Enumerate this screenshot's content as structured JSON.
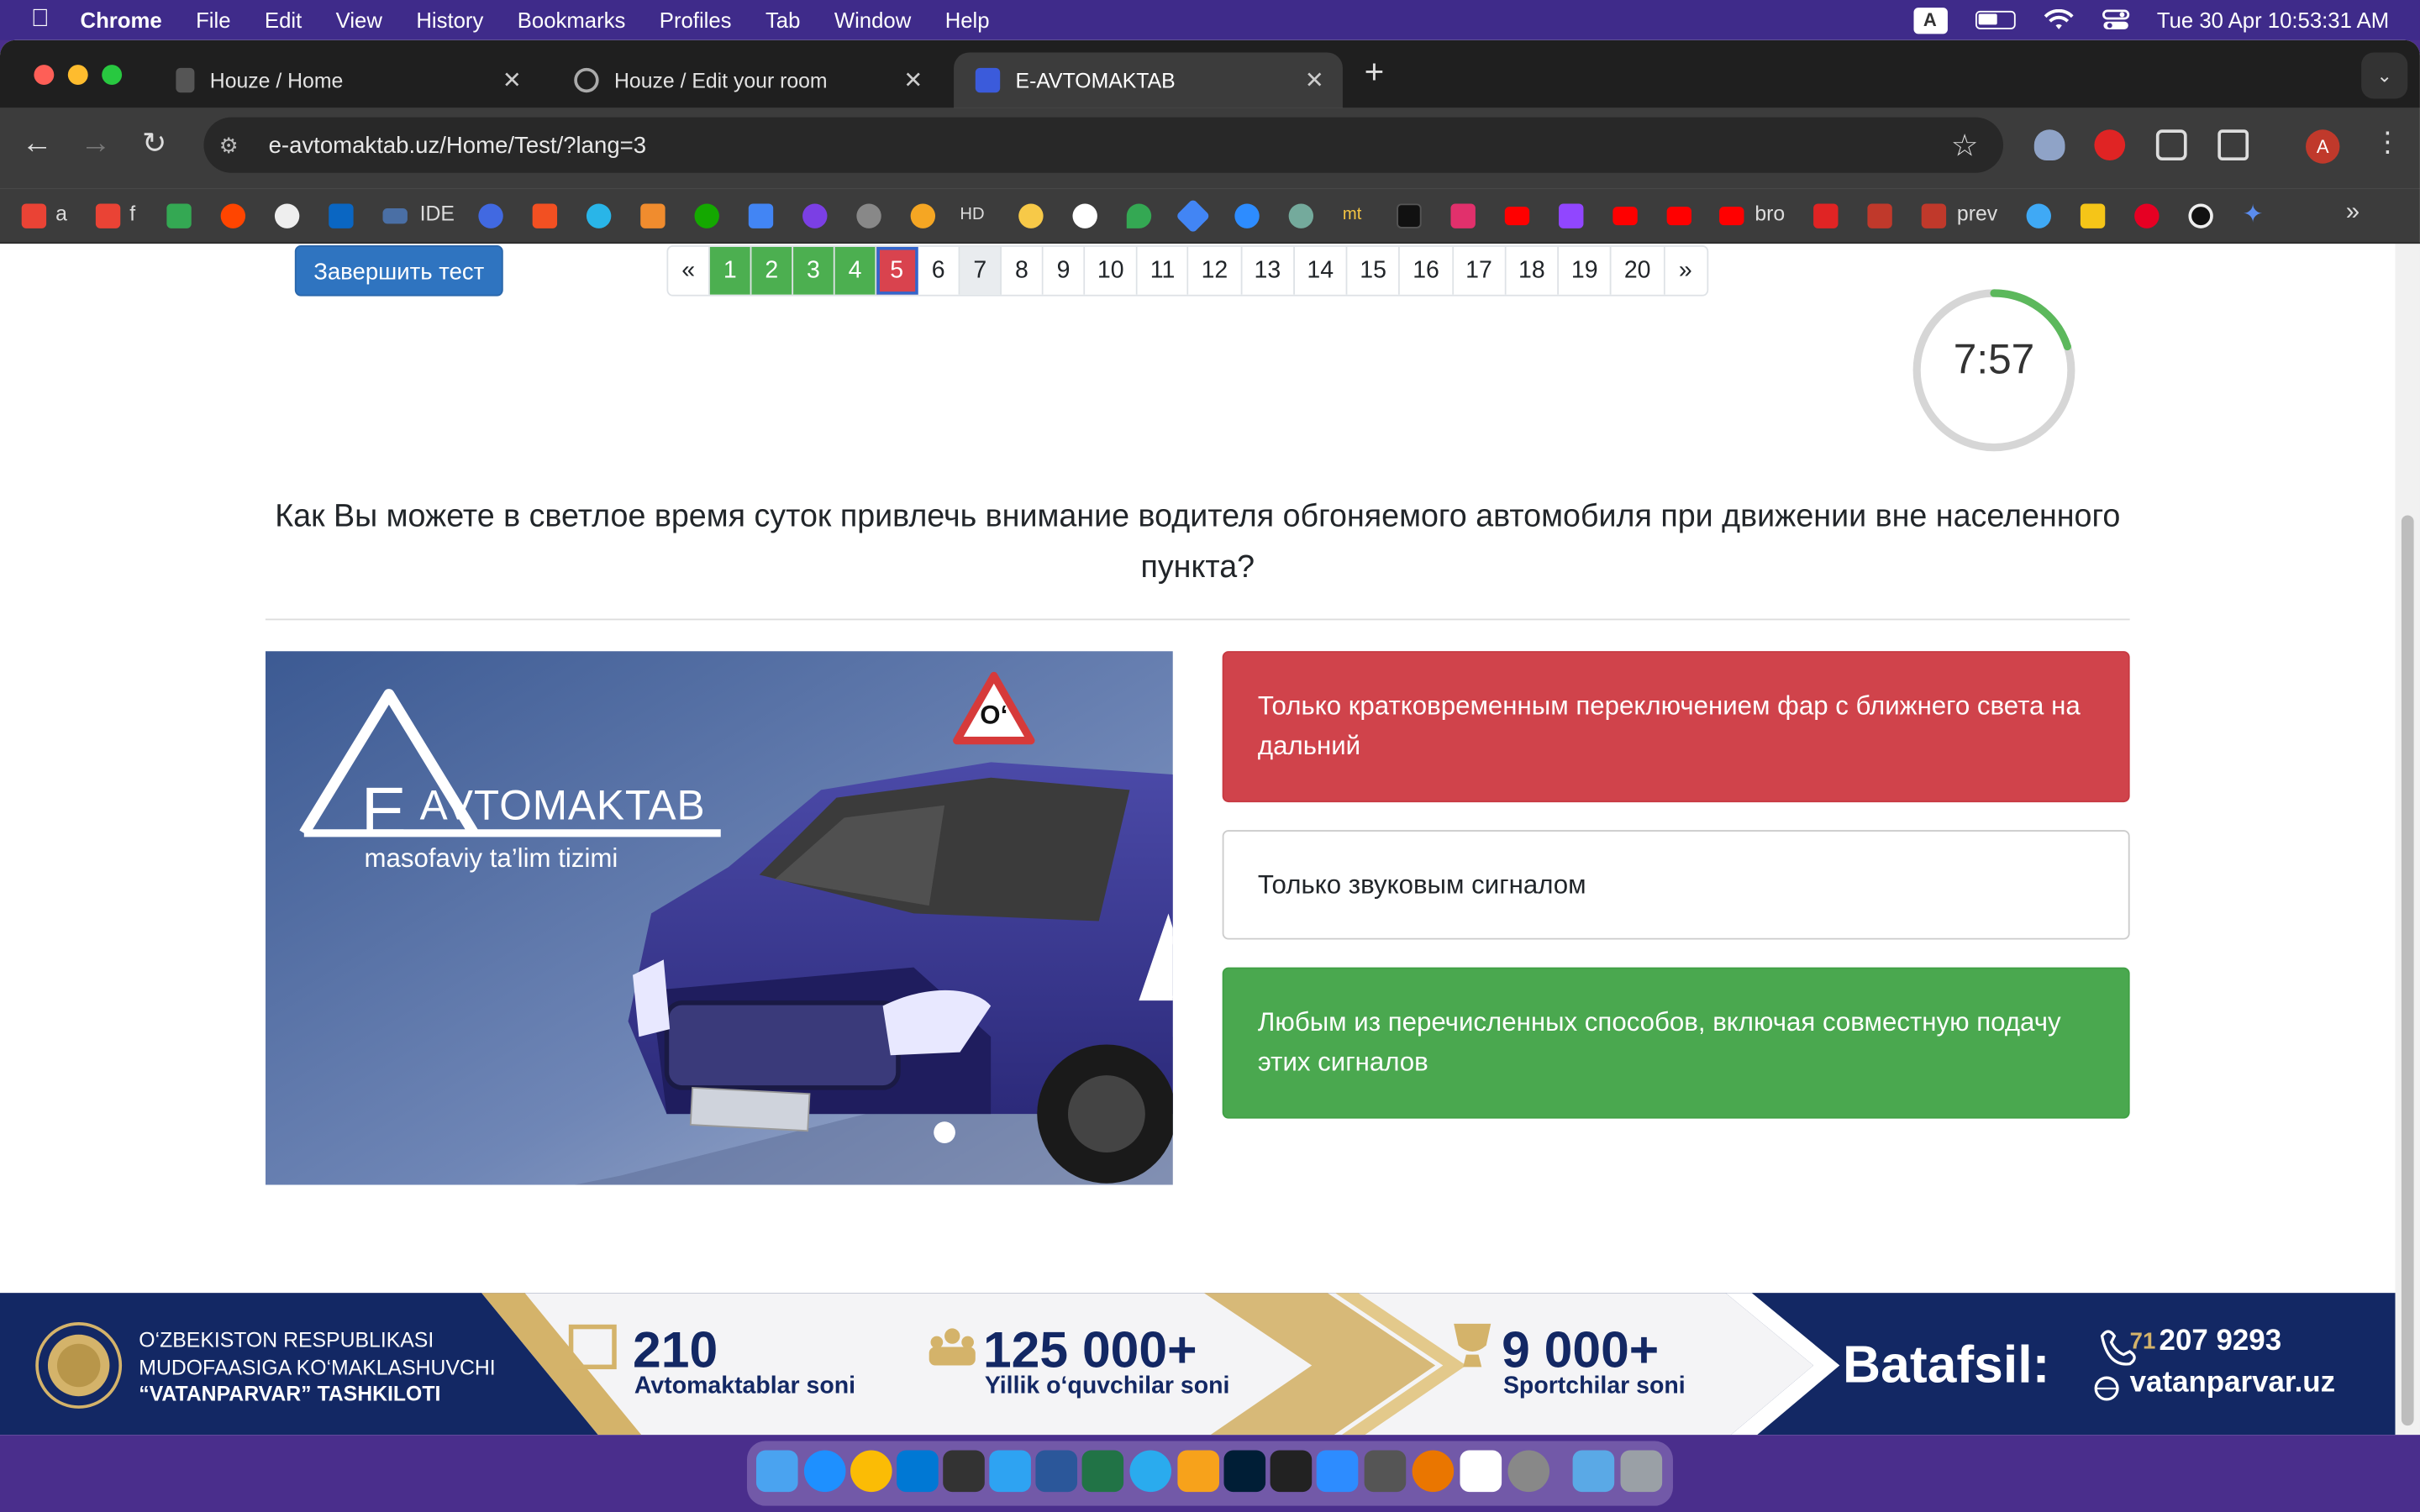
{
  "menubar": {
    "app": "Chrome",
    "items": [
      "File",
      "Edit",
      "View",
      "History",
      "Bookmarks",
      "Profiles",
      "Tab",
      "Window",
      "Help"
    ],
    "input_indicator": "A",
    "datetime": "Tue 30 Apr  10:53:31 AM"
  },
  "tabs": [
    {
      "title": "Houze / Home",
      "active": false
    },
    {
      "title": "Houze / Edit your room",
      "active": false
    },
    {
      "title": "E-AVTOMAKTAB",
      "active": true
    }
  ],
  "omnibox": {
    "url": "e-avtomaktab.uz/Home/Test/?lang=3"
  },
  "profile_initial": "A",
  "bookmarks": {
    "a": "a",
    "f": "f",
    "ide": "IDE",
    "hd": "HD",
    "mt": "mt",
    "bro": "bro",
    "prev": "prev"
  },
  "test": {
    "finish_button": "Завершить тест",
    "pager": {
      "prev": "«",
      "next": "»",
      "pages": [
        {
          "n": "1",
          "state": "correct"
        },
        {
          "n": "2",
          "state": "correct"
        },
        {
          "n": "3",
          "state": "correct"
        },
        {
          "n": "4",
          "state": "correct"
        },
        {
          "n": "5",
          "state": "wrong"
        },
        {
          "n": "6",
          "state": ""
        },
        {
          "n": "7",
          "state": "current"
        },
        {
          "n": "8",
          "state": ""
        },
        {
          "n": "9",
          "state": ""
        },
        {
          "n": "10",
          "state": ""
        },
        {
          "n": "11",
          "state": ""
        },
        {
          "n": "12",
          "state": ""
        },
        {
          "n": "13",
          "state": ""
        },
        {
          "n": "14",
          "state": ""
        },
        {
          "n": "15",
          "state": ""
        },
        {
          "n": "16",
          "state": ""
        },
        {
          "n": "17",
          "state": ""
        },
        {
          "n": "18",
          "state": ""
        },
        {
          "n": "19",
          "state": ""
        },
        {
          "n": "20",
          "state": ""
        }
      ]
    },
    "timer": {
      "text": "7:57",
      "remaining_fraction": 0.2,
      "color": "#5cb85c"
    },
    "question": "Как Вы можете в светлое время суток привлечь внимание водителя обгоняемого автомобиля при движении вне населенного пункта?",
    "image": {
      "logo_letter": "E",
      "logo_text": "AVTOMAKTAB",
      "tagline": "masofaviy ta’lim tizimi",
      "roof_sign": "O‘"
    },
    "answers": [
      {
        "text": "Только кратковременным переключением фар с ближнего света на дальний",
        "state": "wrong"
      },
      {
        "text": "Только звуковым сигналом",
        "state": "neutral"
      },
      {
        "text": "Любым из перечисленных способов, включая совместную подачу этих сигналов",
        "state": "correct"
      }
    ]
  },
  "banner": {
    "org_line1": "O‘ZBEKISTON RESPUBLIKASI",
    "org_line2": "MUDOFAASIGA KO‘MAKLASHUVCHI",
    "org_line3": "“VATANPARVAR” TASHKILOTI",
    "stats": [
      {
        "value": "210",
        "label": "Avtomaktablar soni"
      },
      {
        "value": "125 000+",
        "label": "Yillik o‘quvchilar soni"
      },
      {
        "value": "9 000+",
        "label": "Sportchilar soni"
      }
    ],
    "cta": "Batafsil:",
    "phone_prefix": "71",
    "phone": "207 9293",
    "website": "vatanparvar.uz"
  },
  "colors": {
    "correct": "#4aa84f",
    "wrong": "#d0434b",
    "primary": "#2f74c0",
    "banner_navy": "#132864",
    "gold": "#d4b36a"
  }
}
